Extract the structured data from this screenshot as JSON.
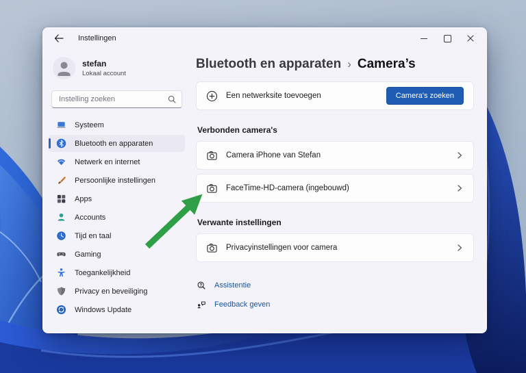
{
  "window": {
    "title": "Instellingen"
  },
  "sidebar": {
    "profile": {
      "name": "stefan",
      "account_type": "Lokaal account"
    },
    "search": {
      "placeholder": "Instelling zoeken"
    },
    "items": [
      {
        "label": "Systeem",
        "icon": "laptop-icon",
        "active": false
      },
      {
        "label": "Bluetooth en apparaten",
        "icon": "bluetooth-icon",
        "active": true
      },
      {
        "label": "Netwerk en internet",
        "icon": "wifi-icon",
        "active": false
      },
      {
        "label": "Persoonlijke instellingen",
        "icon": "paintbrush-icon",
        "active": false
      },
      {
        "label": "Apps",
        "icon": "apps-grid-icon",
        "active": false
      },
      {
        "label": "Accounts",
        "icon": "person-icon",
        "active": false
      },
      {
        "label": "Tijd en taal",
        "icon": "clock-icon",
        "active": false
      },
      {
        "label": "Gaming",
        "icon": "gamepad-icon",
        "active": false
      },
      {
        "label": "Toegankelijkheid",
        "icon": "accessibility-icon",
        "active": false
      },
      {
        "label": "Privacy en beveiliging",
        "icon": "shield-icon",
        "active": false
      },
      {
        "label": "Windows Update",
        "icon": "update-icon",
        "active": false
      }
    ]
  },
  "content": {
    "breadcrumb": {
      "parent": "Bluetooth en apparaten",
      "separator": "›",
      "current": "Camera’s"
    },
    "add_network": {
      "label": "Een netwerksite toevoegen",
      "button_label": "Camera's zoeken"
    },
    "connected_section": {
      "title": "Verbonden camera's",
      "items": [
        {
          "label": "Camera iPhone van Stefan"
        },
        {
          "label": "FaceTime-HD-camera (ingebouwd)"
        }
      ]
    },
    "related_section": {
      "title": "Verwante instellingen",
      "items": [
        {
          "label": "Privacyinstellingen voor camera"
        }
      ]
    },
    "footer_links": [
      {
        "label": "Assistentie",
        "icon": "help-icon"
      },
      {
        "label": "Feedback geven",
        "icon": "feedback-icon"
      }
    ]
  },
  "annotation": {
    "arrow_color": "#2f9f47"
  },
  "colors": {
    "accent_blue": "#1f5db5",
    "selected_pill": "#2d62c6",
    "window_bg": "#f4f3fa",
    "card_bg": "#fdfdfe",
    "link_blue": "#15559e"
  }
}
